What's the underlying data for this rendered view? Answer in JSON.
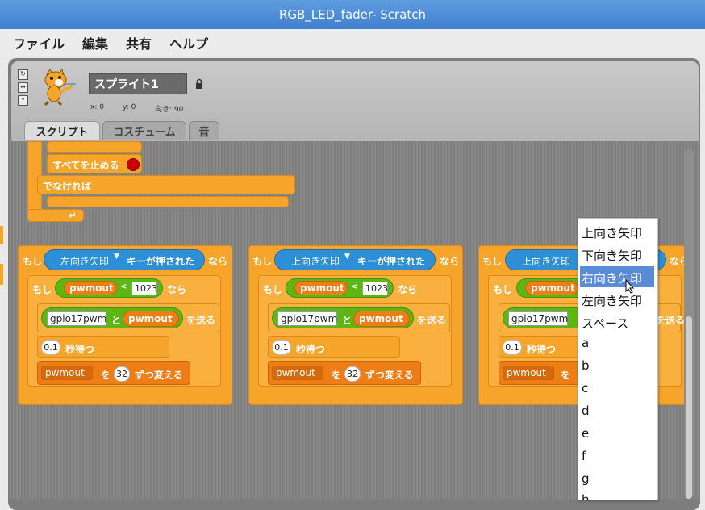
{
  "window": {
    "title": "RGB_LED_fader- Scratch"
  },
  "menu": [
    "ファイル",
    "編集",
    "共有",
    "ヘルプ"
  ],
  "sprite": {
    "name": "スプライト1",
    "x_label": "x: 0",
    "y_label": "y: 0",
    "dir_label": "向き: 90"
  },
  "tabs": [
    "スクリプト",
    "コスチューム",
    "音"
  ],
  "top_script": {
    "stop_all": "すべてを止める",
    "else": "でなければ"
  },
  "script_blocks": {
    "if": "もし",
    "key_pressed": "キーが押された",
    "then": "なら",
    "lt": "<",
    "var_name": "pwmout",
    "limit": "1023",
    "pin_name": "gpio17pwm",
    "and": "と",
    "send": "を送る",
    "wait_value": "0.1",
    "wait": "秒待つ",
    "change_by": "を",
    "change_value": "32",
    "change_suffix": "ずつ変える"
  },
  "scripts": [
    {
      "key": "左向き矢印"
    },
    {
      "key": "上向き矢印"
    },
    {
      "key": "上向き矢印"
    }
  ],
  "dropdown": {
    "items": [
      "上向き矢印",
      "下向き矢印",
      "右向き矢印",
      "左向き矢印",
      "スペース",
      "a",
      "b",
      "c",
      "d",
      "e",
      "f",
      "g",
      "h"
    ],
    "selected": "右向き矢印"
  }
}
